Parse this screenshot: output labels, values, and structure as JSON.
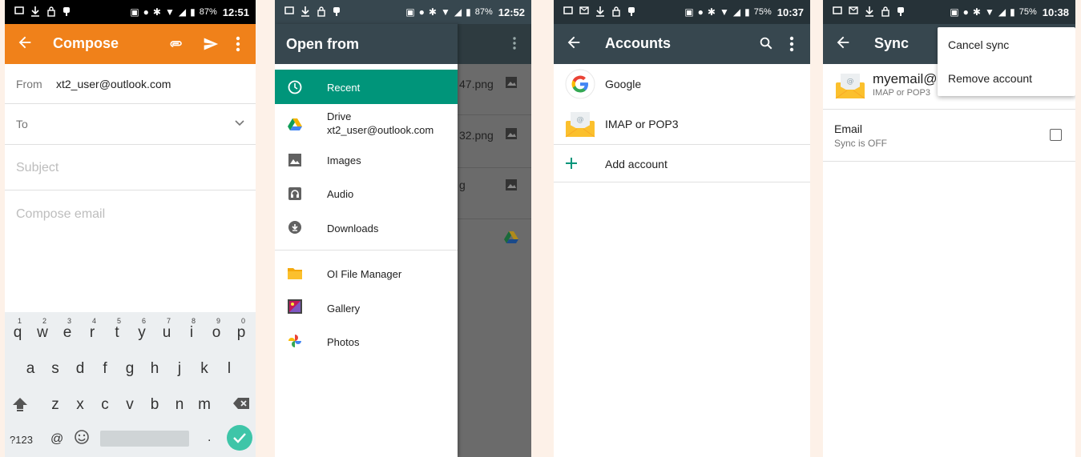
{
  "colors": {
    "orange": "#f0811a",
    "dark_bar": "#37474f",
    "teal": "#00957a",
    "green_check": "#3ec5a8",
    "keyboard_bg": "#eceff1",
    "gutter": "#fdf1e8"
  },
  "screen1": {
    "status": {
      "battery": "87%",
      "time": "12:51"
    },
    "appbar_title": "Compose",
    "from_label": "From",
    "from_value": "xt2_user@outlook.com",
    "to_label": "To",
    "subject_placeholder": "Subject",
    "body_placeholder": "Compose email",
    "keyboard": {
      "row1": [
        "q",
        "w",
        "e",
        "r",
        "t",
        "y",
        "u",
        "i",
        "o",
        "p"
      ],
      "row1_hints": [
        "1",
        "2",
        "3",
        "4",
        "5",
        "6",
        "7",
        "8",
        "9",
        "0"
      ],
      "row2": [
        "a",
        "s",
        "d",
        "f",
        "g",
        "h",
        "j",
        "k",
        "l"
      ],
      "row3": [
        "z",
        "x",
        "c",
        "v",
        "b",
        "n",
        "m"
      ],
      "symbols_key": "?123",
      "at_key": "@",
      "period_key": "."
    }
  },
  "screen2": {
    "status": {
      "battery": "87%",
      "time": "12:52"
    },
    "drawer_title": "Open from",
    "items": [
      {
        "label": "Recent",
        "icon": "clock-icon"
      },
      {
        "label": "Drive",
        "sublabel": "xt2_user@outlook.com",
        "icon": "drive-icon"
      },
      {
        "label": "Images",
        "icon": "image-icon"
      },
      {
        "label": "Audio",
        "icon": "audio-icon"
      },
      {
        "label": "Downloads",
        "icon": "download-icon"
      },
      {
        "label": "OI File Manager",
        "icon": "folder-icon"
      },
      {
        "label": "Gallery",
        "icon": "gallery-icon"
      },
      {
        "label": "Photos",
        "icon": "photos-icon"
      }
    ],
    "background_files": [
      "47.png",
      "32.png",
      "g"
    ]
  },
  "screen3": {
    "status": {
      "battery": "75%",
      "time": "10:37"
    },
    "appbar_title": "Accounts",
    "accounts": [
      {
        "label": "Google",
        "icon": "google-icon"
      },
      {
        "label": "IMAP or POP3",
        "icon": "email-envelope-icon"
      }
    ],
    "add_account": "Add account"
  },
  "screen4": {
    "status": {
      "battery": "75%",
      "time": "10:38"
    },
    "appbar_title": "Sync",
    "account_name": "myemail@bi",
    "account_type": "IMAP or POP3",
    "sync_item_title": "Email",
    "sync_item_status": "Sync is OFF",
    "menu": [
      "Cancel sync",
      "Remove account"
    ]
  }
}
